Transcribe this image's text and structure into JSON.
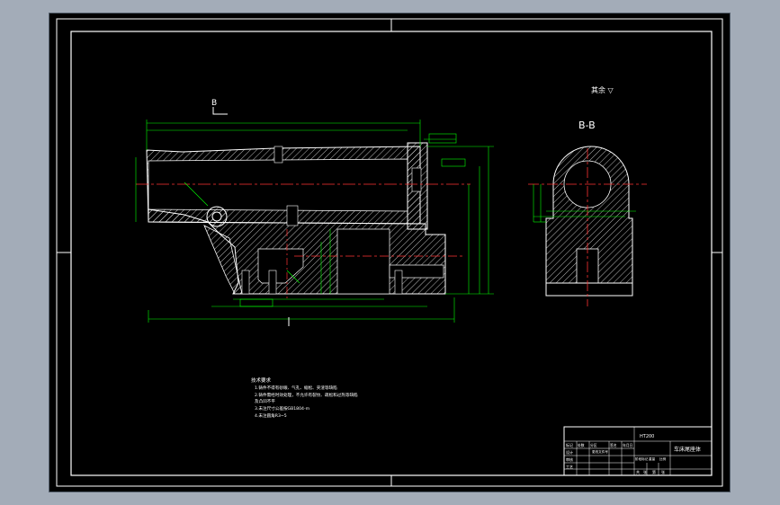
{
  "drawing": {
    "section_label": "B-B",
    "section_marker": "B",
    "surface_note": "其余 ▽",
    "tech_requirements": {
      "title": "技术要求",
      "lines": [
        "1.铸件不得有砂眼、气孔、缩松、夹渣等缺陷",
        "2.铸件需经时效处理，不允许有裂纹、疏松和过热等缺陷",
        "  及凸凹不平",
        "3.未注尺寸公差按GB1804-m",
        "4.未注圆角R3~5"
      ]
    },
    "title_block": {
      "material": "HT200",
      "part_name": "车床尾座体",
      "row_labels": [
        "标记",
        "设计",
        "审核",
        "工艺"
      ],
      "header_cells": [
        "处数",
        "分区",
        "更改文件号",
        "签名",
        "年月日"
      ],
      "scale_row": [
        "阶段标记",
        "重量",
        "比例"
      ],
      "bottom_row": [
        "共",
        "张",
        "第",
        "张"
      ]
    },
    "colors": {
      "background": "#000000",
      "frame": "#ffffff",
      "dimension": "#00ff00",
      "hatch": "#ffffff",
      "centerline": "#ff3333",
      "workspace": "#a3acb8"
    }
  }
}
